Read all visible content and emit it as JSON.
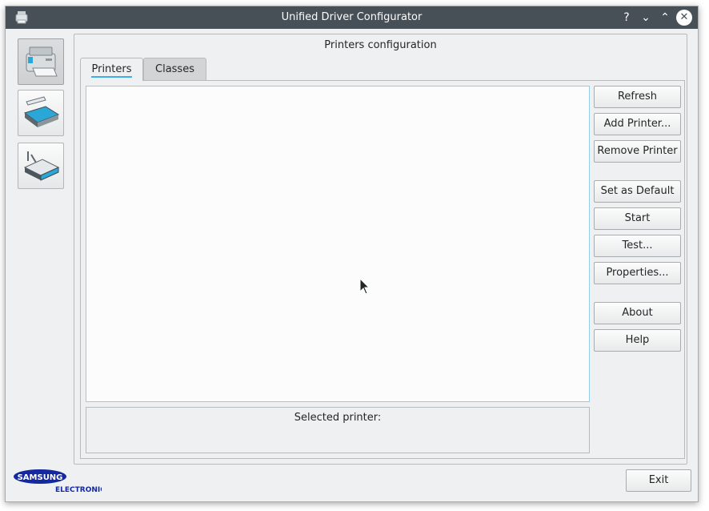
{
  "window": {
    "title": "Unified Driver Configurator",
    "controls": {
      "help": "?",
      "minimize": "⌄",
      "maximize": "⌃",
      "close": "✕"
    }
  },
  "sidebar": {
    "items": [
      {
        "name": "printers",
        "icon": "printer-icon",
        "active": true
      },
      {
        "name": "scanners",
        "icon": "scanner-icon",
        "active": false
      },
      {
        "name": "ports",
        "icon": "port-icon",
        "active": false
      }
    ]
  },
  "panel": {
    "title": "Printers configuration",
    "tabs": [
      {
        "label": "Printers"
      },
      {
        "label": "Classes"
      }
    ],
    "selected_label": "Selected printer:"
  },
  "actions": {
    "refresh": "Refresh",
    "add_printer": "Add Printer...",
    "remove_printer": "Remove Printer",
    "set_default": "Set as Default",
    "start": "Start",
    "test": "Test...",
    "properties": "Properties...",
    "about": "About",
    "help": "Help"
  },
  "footer": {
    "brand_top": "SAMSUNG",
    "brand_bottom": "ELECTRONICS",
    "exit": "Exit"
  },
  "colors": {
    "titlebar": "#475057",
    "accent": "#3daee9",
    "brand": "#1428a0"
  }
}
